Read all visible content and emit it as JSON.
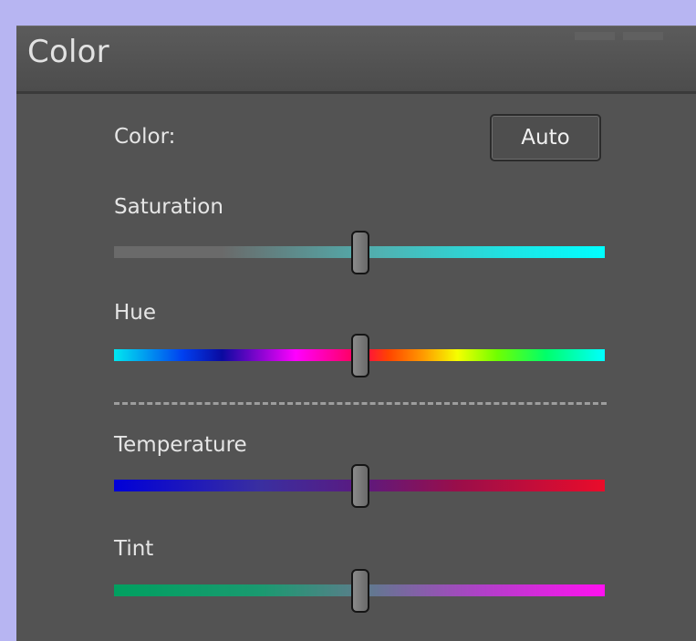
{
  "panel": {
    "title": "Color"
  },
  "color_row": {
    "label": "Color:",
    "auto_button_label": "Auto"
  },
  "sliders": [
    {
      "id": "saturation",
      "label": "Saturation",
      "value_fraction": 0.5
    },
    {
      "id": "hue",
      "label": "Hue",
      "value_fraction": 0.5
    },
    {
      "id": "temperature",
      "label": "Temperature",
      "value_fraction": 0.5
    },
    {
      "id": "tint",
      "label": "Tint",
      "value_fraction": 0.5
    }
  ],
  "colors": {
    "page_background": "#b7b5f2",
    "panel_background": "#535353",
    "text": "#e6e6e6",
    "saturation_end": "#00ffff",
    "temperature_start": "#0000d8",
    "temperature_end": "#ea0c2a",
    "tint_start": "#00a060",
    "tint_end": "#ff10f0"
  },
  "icons": {
    "slider_thumb": "rounded-rectangle-thumb"
  }
}
